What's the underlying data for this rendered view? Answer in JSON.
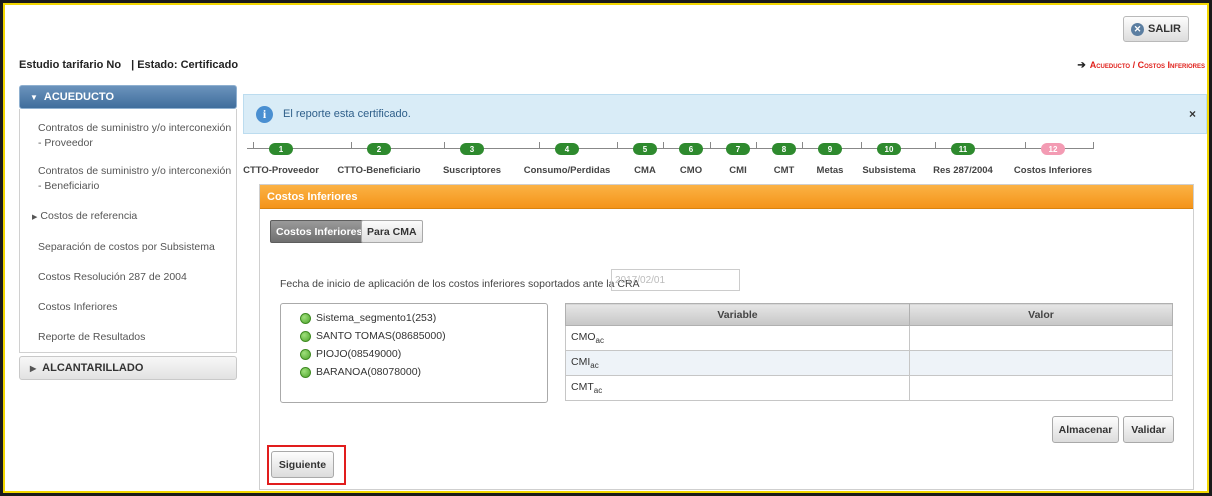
{
  "header": {
    "logout_label": "SALIR",
    "study_label": "Estudio tarifario No",
    "status_label": "| Estado: Certificado",
    "breadcrumb": "Acueducto / Costos Inferiores"
  },
  "sidebar": {
    "section1": "ACUEDUCTO",
    "items": [
      {
        "label": "Contratos de suministro y/o interconexión - Proveedor"
      },
      {
        "label": "Contratos de suministro y/o interconexión - Beneficiario"
      },
      {
        "label": "Costos de referencia"
      },
      {
        "label": "Separación de costos por Subsistema"
      },
      {
        "label": "Costos Resolución 287 de 2004"
      },
      {
        "label": "Costos Inferiores"
      },
      {
        "label": "Reporte de Resultados"
      }
    ],
    "section2": "ALCANTARILLADO"
  },
  "alert": {
    "message": "El reporte esta certificado.",
    "close": "×"
  },
  "steps": [
    {
      "num": "1",
      "label": "CTTO-Proveedor"
    },
    {
      "num": "2",
      "label": "CTTO-Beneficiario"
    },
    {
      "num": "3",
      "label": "Suscriptores"
    },
    {
      "num": "4",
      "label": "Consumo/Perdidas"
    },
    {
      "num": "5",
      "label": "CMA"
    },
    {
      "num": "6",
      "label": "CMO"
    },
    {
      "num": "7",
      "label": "CMI"
    },
    {
      "num": "8",
      "label": "CMT"
    },
    {
      "num": "9",
      "label": "Metas"
    },
    {
      "num": "10",
      "label": "Subsistema"
    },
    {
      "num": "11",
      "label": "Res 287/2004"
    },
    {
      "num": "12",
      "label": "Costos Inferiores"
    }
  ],
  "panel": {
    "title": "Costos Inferiores",
    "tab_active": "Costos Inferiores",
    "tab_other": "Para CMA",
    "date_label": "Fecha de inicio de aplicación de los costos inferiores soportados ante la CRA",
    "date_value": "2017/02/01",
    "tree": [
      "Sistema_segmento1(253)",
      "SANTO TOMAS(08685000)",
      "PIOJO(08549000)",
      "BARANOA(08078000)"
    ],
    "table": {
      "headers": [
        "Variable",
        "Valor"
      ],
      "rows": [
        {
          "var": "CMO",
          "sub": "ac",
          "value": ""
        },
        {
          "var": "CMI",
          "sub": "ac",
          "value": ""
        },
        {
          "var": "CMT",
          "sub": "ac",
          "value": ""
        }
      ]
    },
    "store_label": "Almacenar",
    "validate_label": "Validar",
    "next_label": "Siguiente"
  }
}
